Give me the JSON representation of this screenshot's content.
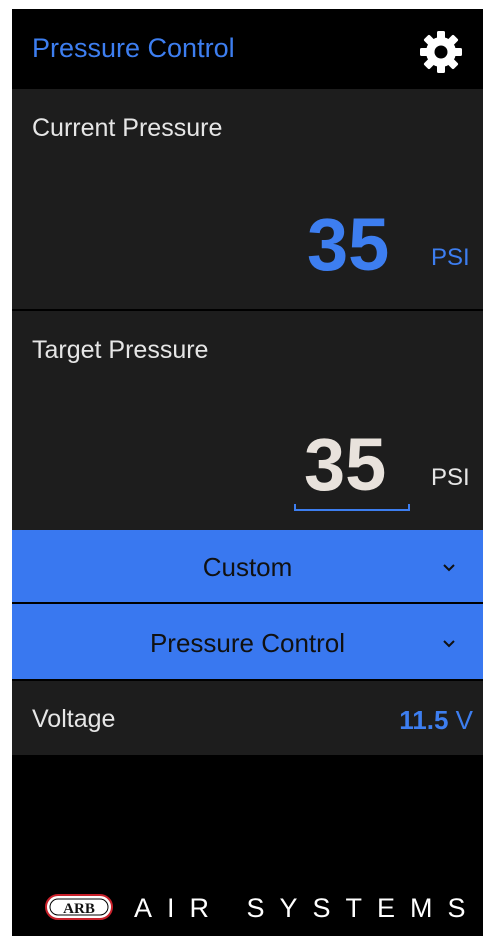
{
  "header": {
    "title": "Pressure Control"
  },
  "current": {
    "label": "Current Pressure",
    "value": "35",
    "unit": "PSI"
  },
  "target": {
    "label": "Target Pressure",
    "value": "35",
    "unit": "PSI"
  },
  "dropdowns": {
    "profile": {
      "selected": "Custom"
    },
    "mode": {
      "selected": "Pressure Control"
    }
  },
  "voltage": {
    "label": "Voltage",
    "value": "11.5",
    "unit": "V"
  },
  "footer": {
    "brand": "ARB",
    "text": "AIR SYSTEMS"
  },
  "colors": {
    "accent": "#3d7ef0",
    "panel": "#1d1d1d",
    "background": "#000000"
  },
  "icons": {
    "settings": "gear-icon",
    "expand": "chevron-down-icon"
  }
}
